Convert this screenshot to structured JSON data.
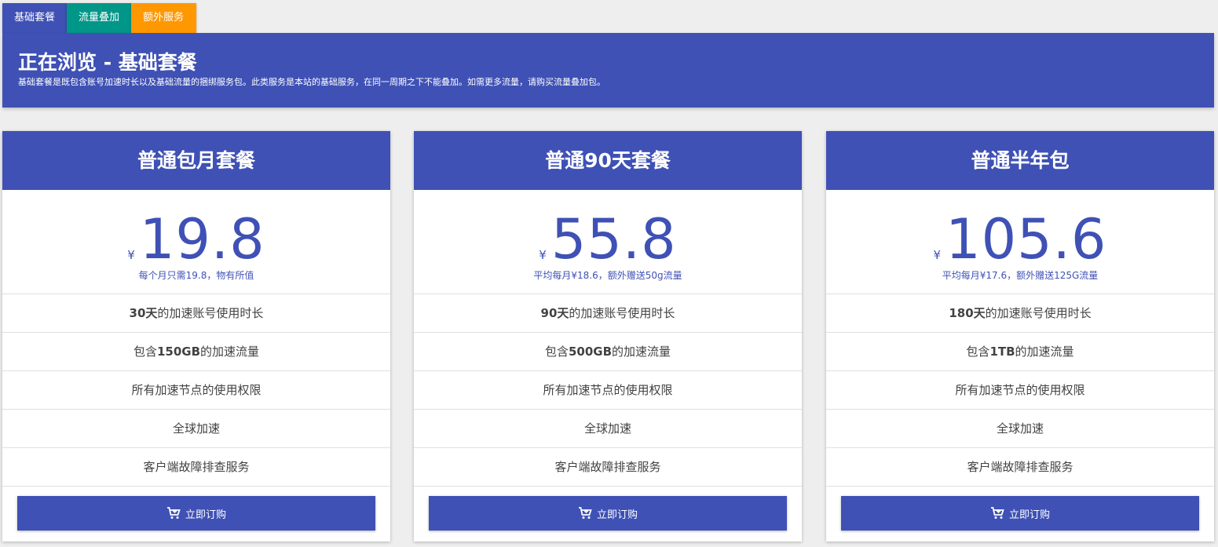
{
  "tabs": [
    {
      "label": "基础套餐"
    },
    {
      "label": "流量叠加"
    },
    {
      "label": "额外服务"
    }
  ],
  "banner": {
    "title": "正在浏览 - 基础套餐",
    "description": "基础套餐是既包含账号加速时长以及基础流量的捆绑服务包。此类服务是本站的基础服务，在同一周期之下不能叠加。如需更多流量，请购买流量叠加包。"
  },
  "currency_symbol": "¥",
  "plans": [
    {
      "name": "普通包月套餐",
      "price": "19.8",
      "price_note": "每个月只需19.8，物有所值",
      "f1_bold": "30天",
      "f1_rest": "的加速账号使用时长",
      "f2_pre": "包含",
      "f2_bold": "150GB",
      "f2_rest": "的加速流量",
      "f3": "所有加速节点的使用权限",
      "f4": "全球加速",
      "f5": "客户端故障排查服务",
      "button": "立即订购"
    },
    {
      "name": "普通90天套餐",
      "price": "55.8",
      "price_note": "平均每月¥18.6，额外赠送50g流量",
      "f1_bold": "90天",
      "f1_rest": "的加速账号使用时长",
      "f2_pre": "包含",
      "f2_bold": "500GB",
      "f2_rest": "的加速流量",
      "f3": "所有加速节点的使用权限",
      "f4": "全球加速",
      "f5": "客户端故障排查服务",
      "button": "立即订购"
    },
    {
      "name": "普通半年包",
      "price": "105.6",
      "price_note": "平均每月¥17.6，额外赠送125G流量",
      "f1_bold": "180天",
      "f1_rest": "的加速账号使用时长",
      "f2_pre": "包含",
      "f2_bold": "1TB",
      "f2_rest": "的加速流量",
      "f3": "所有加速节点的使用权限",
      "f4": "全球加速",
      "f5": "客户端故障排查服务",
      "button": "立即订购"
    }
  ],
  "colors": {
    "primary": "#3f51b5",
    "tab_traffic": "#009688",
    "tab_extra": "#ff9800"
  },
  "icons": {
    "order_button": "cart-icon"
  }
}
